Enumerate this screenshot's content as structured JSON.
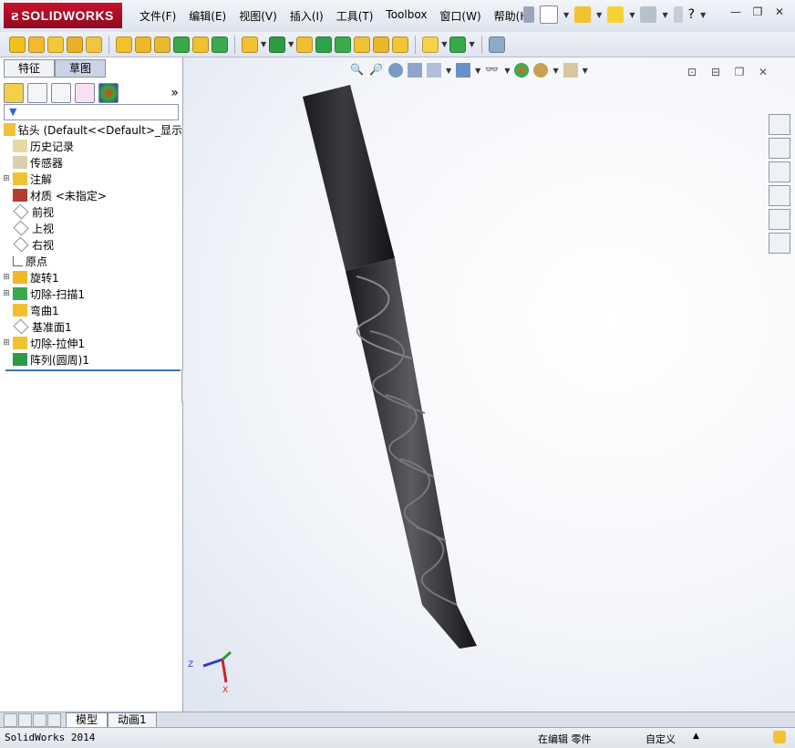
{
  "app": {
    "logo_ds": "ƨ",
    "logo_text": "SOLIDWORKS"
  },
  "menu": [
    "文件(F)",
    "编辑(E)",
    "视图(V)",
    "插入(I)",
    "工具(T)",
    "Toolbox",
    "窗口(W)",
    "帮助(H)"
  ],
  "left_panel": {
    "tabs": [
      "特征",
      "草图"
    ],
    "more_glyph": "»",
    "tree": {
      "root": "钻头  (Default<<Default>_显示",
      "items": [
        {
          "label": "历史记录",
          "icon": "history-icon",
          "expandable": false
        },
        {
          "label": "传感器",
          "icon": "sensor-icon",
          "expandable": false
        },
        {
          "label": "注解",
          "icon": "annotation-icon",
          "expandable": true
        },
        {
          "label": "材质 <未指定>",
          "icon": "material-icon",
          "expandable": false
        },
        {
          "label": "前视",
          "icon": "plane-icon",
          "expandable": false
        },
        {
          "label": "上视",
          "icon": "plane-icon",
          "expandable": false
        },
        {
          "label": "右视",
          "icon": "plane-icon",
          "expandable": false
        },
        {
          "label": "原点",
          "icon": "origin-icon",
          "expandable": false
        },
        {
          "label": "旋转1",
          "icon": "revolve-icon",
          "expandable": true
        },
        {
          "label": "切除-扫描1",
          "icon": "swept-cut-icon",
          "expandable": true
        },
        {
          "label": "弯曲1",
          "icon": "flex-icon",
          "expandable": false
        },
        {
          "label": "基准面1",
          "icon": "plane-icon",
          "expandable": false
        },
        {
          "label": "切除-拉伸1",
          "icon": "extruded-cut-icon",
          "expandable": true
        },
        {
          "label": "阵列(圆周)1",
          "icon": "circular-pattern-icon",
          "expandable": false
        }
      ]
    }
  },
  "triad": {
    "z": "Z",
    "x": "X"
  },
  "bottom_tabs": [
    "模型",
    "动画1"
  ],
  "status": {
    "app": "SolidWorks 2014",
    "mode": "在编辑 零件",
    "units": "自定义"
  },
  "colors": {
    "brand": "#c8102e",
    "tree_line": "#3a73c0",
    "drill": "#2b2b2e"
  }
}
